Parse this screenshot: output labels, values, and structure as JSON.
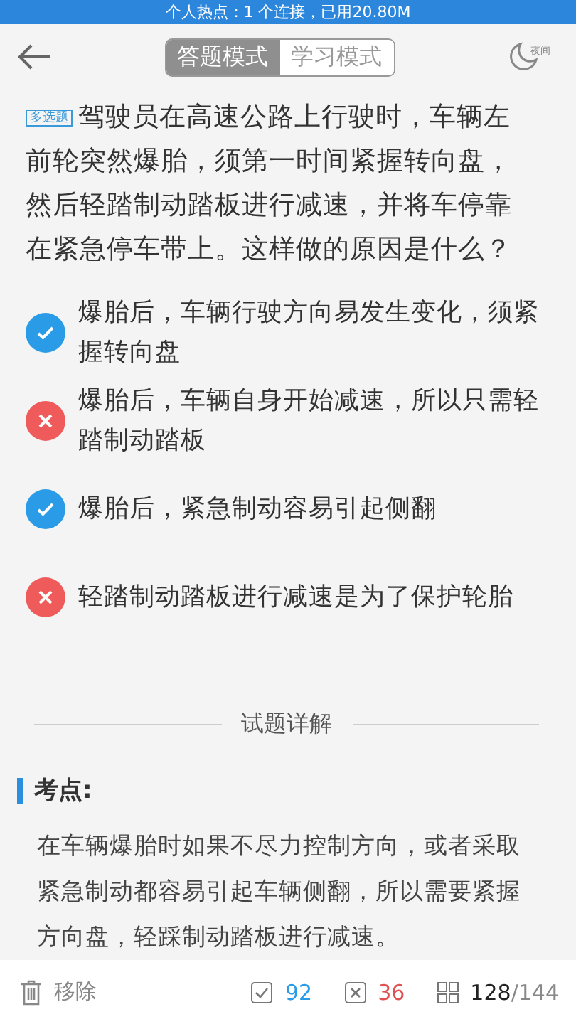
{
  "status_bar": {
    "text": "个人热点：1 个连接，已用20.80M"
  },
  "header": {
    "tabs": [
      {
        "label": "答题模式",
        "selected": true
      },
      {
        "label": "学习模式",
        "selected": false
      }
    ],
    "night_label": "夜间"
  },
  "question": {
    "type_badge": "多选题",
    "text": "驾驶员在高速公路上行驶时，车辆左前轮突然爆胎，须第一时间紧握转向盘，然后轻踏制动踏板进行减速，并将车停靠在紧急停车带上。这样做的原因是什么？"
  },
  "options": [
    {
      "text": "爆胎后，车辆行驶方向易发生变化，须紧握转向盘",
      "correct": true
    },
    {
      "text": "爆胎后，车辆自身开始减速，所以只需轻踏制动踏板",
      "correct": false
    },
    {
      "text": "爆胎后，紧急制动容易引起侧翻",
      "correct": true
    },
    {
      "text": "轻踏制动踏板进行减速是为了保护轮胎",
      "correct": false
    }
  ],
  "explanation": {
    "title": "试题详解",
    "section": "考点:",
    "text": "在车辆爆胎时如果不尽力控制方向，或者采取紧急制动都容易引起车辆侧翻，所以需要紧握方向盘，轻踩制动踏板进行减速。"
  },
  "bottom_bar": {
    "remove": "移除",
    "correct_count": "92",
    "wrong_count": "36",
    "current": "128",
    "total": "/144"
  }
}
